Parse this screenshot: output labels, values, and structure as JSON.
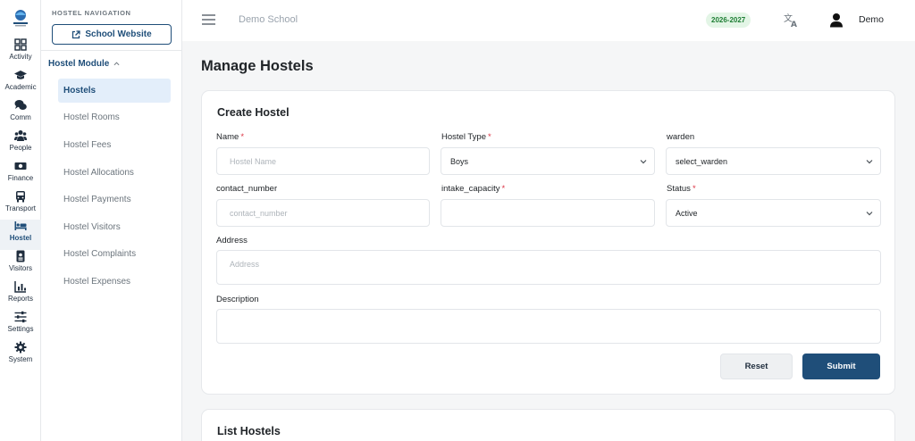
{
  "rail": {
    "items": [
      {
        "label": "Activity",
        "icon": "grid-icon"
      },
      {
        "label": "Academic",
        "icon": "graduation-cap-icon"
      },
      {
        "label": "Comm",
        "icon": "comments-icon"
      },
      {
        "label": "People",
        "icon": "users-icon"
      },
      {
        "label": "Finance",
        "icon": "money-icon"
      },
      {
        "label": "Transport",
        "icon": "bus-icon"
      },
      {
        "label": "Hostel",
        "icon": "bed-icon"
      },
      {
        "label": "Visitors",
        "icon": "id-badge-icon"
      },
      {
        "label": "Reports",
        "icon": "bar-chart-icon"
      },
      {
        "label": "Settings",
        "icon": "sliders-icon"
      },
      {
        "label": "System",
        "icon": "gear-icon"
      }
    ],
    "active": "Hostel"
  },
  "subnav": {
    "heading": "HOSTEL NAVIGATION",
    "website_button": "School Website",
    "module_label": "Hostel Module",
    "items": [
      "Hostels",
      "Hostel Rooms",
      "Hostel Fees",
      "Hostel Allocations",
      "Hostel Payments",
      "Hostel Visitors",
      "Hostel Complaints",
      "Hostel Expenses"
    ],
    "active": "Hostels"
  },
  "header": {
    "school_name": "Demo School",
    "session_year": "2026-2027",
    "user_name": "Demo"
  },
  "page": {
    "title": "Manage Hostels"
  },
  "form": {
    "title": "Create Hostel",
    "name_label": "Name",
    "name_placeholder": "Hostel Name",
    "type_label": "Hostel Type",
    "type_value": "Boys",
    "warden_label": "warden",
    "warden_value": "select_warden",
    "contact_label": "contact_number",
    "contact_placeholder": "contact_number",
    "capacity_label": "intake_capacity",
    "capacity_value": "",
    "status_label": "Status",
    "status_value": "Active",
    "address_label": "Address",
    "address_placeholder": "Address",
    "description_label": "Description",
    "description_value": "",
    "required_marker": "*",
    "reset_label": "Reset",
    "submit_label": "Submit"
  },
  "list": {
    "title": "List Hostels"
  },
  "colors": {
    "primary": "#1f4e79",
    "required": "#dc3545",
    "badge_bg": "#e3f5e6",
    "badge_text": "#1e7e34",
    "active_bg": "#e3eefa"
  }
}
